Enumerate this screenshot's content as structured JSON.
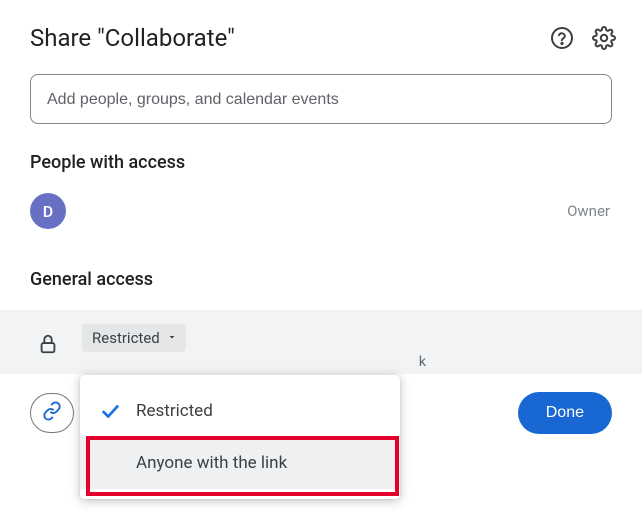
{
  "header": {
    "title": "Share \"Collaborate\""
  },
  "input": {
    "placeholder": "Add people, groups, and calendar events"
  },
  "peopleSection": {
    "title": "People with access",
    "avatarInitial": "D",
    "roleLabel": "Owner"
  },
  "generalSection": {
    "title": "General access",
    "selected": "Restricted",
    "hintFragment": "k"
  },
  "dropdown": {
    "option1": "Restricted",
    "option2": "Anyone with the link"
  },
  "footer": {
    "doneLabel": "Done"
  }
}
